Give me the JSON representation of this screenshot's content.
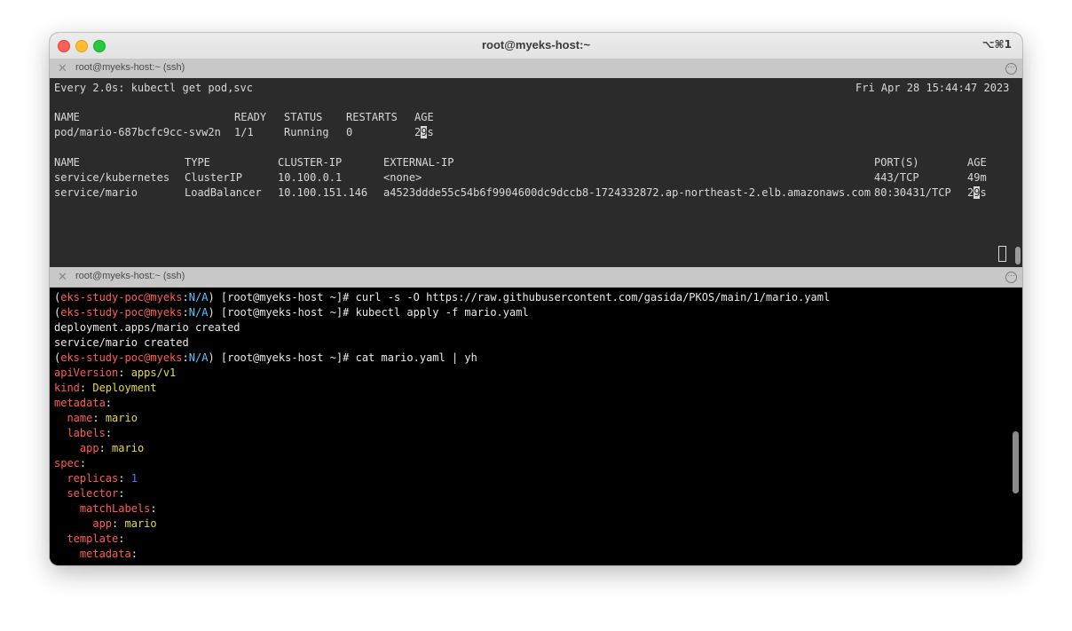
{
  "window": {
    "title": "root@myeks-host:~",
    "shortcut": "⌥⌘1",
    "icons": {
      "close": "close-dot",
      "minimize": "minimize-dot",
      "maximize": "maximize-dot"
    }
  },
  "top_pane": {
    "tab_label": "root@myeks-host:~ (ssh)",
    "header": "Every 2.0s: kubectl get pod,svc",
    "timestamp": "Fri Apr 28 15:44:47 2023",
    "pod_headers": [
      "NAME",
      "READY",
      "STATUS",
      "RESTARTS",
      "AGE"
    ],
    "pod_row": [
      "pod/mario-687bcfc9cc-svw2n",
      "1/1",
      "Running",
      "0",
      "2",
      "9",
      "s"
    ],
    "svc_headers": [
      "NAME",
      "TYPE",
      "CLUSTER-IP",
      "EXTERNAL-IP",
      "PORT(S)",
      "AGE"
    ],
    "svc_rows": [
      [
        "service/kubernetes",
        "ClusterIP",
        "10.100.0.1",
        "<none>",
        "443/TCP",
        "49m"
      ],
      [
        "service/mario",
        "LoadBalancer",
        "10.100.151.146",
        "a4523ddde55c54b6f9904600dc9dccb8-1724332872.ap-northeast-2.elb.amazonaws.com",
        "80:30431/TCP",
        "2",
        "9",
        "s"
      ]
    ]
  },
  "bottom_pane": {
    "tab_label": "root@myeks-host:~ (ssh)",
    "prompt": {
      "open": "(",
      "context": "eks-study-poc@myeks",
      "colon": ":",
      "namespace": "N/A",
      "rest": ") [root@myeks-host ~]# "
    },
    "commands": [
      "curl -s -O https://raw.githubusercontent.com/gasida/PKOS/main/1/mario.yaml",
      "kubectl apply -f mario.yaml",
      "cat mario.yaml | yh"
    ],
    "outputs": [
      "deployment.apps/mario created",
      "service/mario created"
    ],
    "yaml": {
      "apiVersion_key": "apiVersion",
      "apiVersion_val": "apps/v1",
      "kind_key": "kind",
      "kind_val": "Deployment",
      "metadata_key": "metadata",
      "name_key": "name",
      "name_val": "mario",
      "labels_key": "labels",
      "app_key": "app",
      "app_val": "mario",
      "spec_key": "spec",
      "replicas_key": "replicas",
      "replicas_val": "1",
      "selector_key": "selector",
      "matchLabels_key": "matchLabels",
      "app2_key": "app",
      "app2_val": "mario",
      "template_key": "template",
      "metadata2_key": "metadata"
    }
  }
}
